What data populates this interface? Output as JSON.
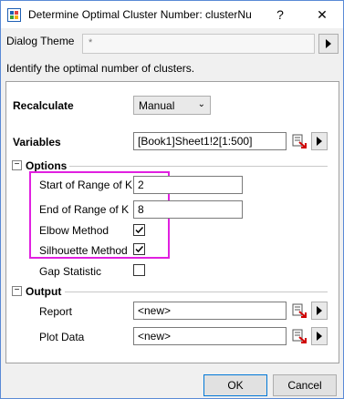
{
  "window": {
    "title": "Determine Optimal Cluster Number: clusterNu"
  },
  "titlebar": {
    "help": "?",
    "close": "✕"
  },
  "theme": {
    "label": "Dialog Theme",
    "value": "*"
  },
  "description": "Identify the optimal number of clusters.",
  "recalculate": {
    "label": "Recalculate",
    "value": "Manual"
  },
  "variables": {
    "label": "Variables",
    "value": "[Book1]Sheet1!2[1:500]"
  },
  "options": {
    "label": "Options",
    "collapse": "−",
    "start_k": {
      "label": "Start of Range of K",
      "value": "2"
    },
    "end_k": {
      "label": "End of Range of K",
      "value": "8"
    },
    "elbow": {
      "label": "Elbow Method",
      "checked": true
    },
    "silhouette": {
      "label": "Silhouette Method",
      "checked": true
    },
    "gap": {
      "label": "Gap Statistic",
      "checked": false
    }
  },
  "output": {
    "label": "Output",
    "collapse": "−",
    "report": {
      "label": "Report",
      "value": "<new>"
    },
    "plot_data": {
      "label": "Plot Data",
      "value": "<new>"
    }
  },
  "buttons": {
    "ok": "OK",
    "cancel": "Cancel"
  }
}
